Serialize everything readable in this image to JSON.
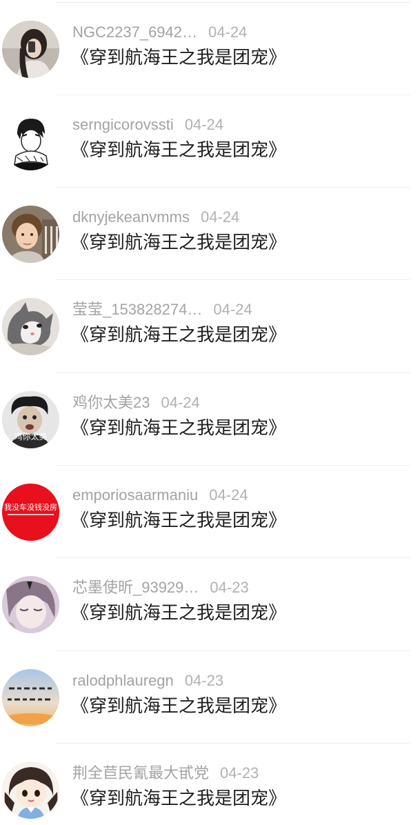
{
  "comments": [
    {
      "username": "NGC2237_6942…",
      "date": "04-24",
      "title": "《穿到航海王之我是团宠》",
      "avatar": "girl-phone-avatar"
    },
    {
      "username": "serngicorovssti",
      "date": "04-24",
      "title": "《穿到航海王之我是团宠》",
      "avatar": "anime-boy-avatar"
    },
    {
      "username": "dknyjekeanvmms",
      "date": "04-24",
      "title": "《穿到航海王之我是团宠》",
      "avatar": "child-photo-avatar"
    },
    {
      "username": "莹莹_153828274…",
      "date": "04-24",
      "title": "《穿到航海王之我是团宠》",
      "avatar": "cat-avatar"
    },
    {
      "username": "鸡你太美23",
      "date": "04-24",
      "title": "《穿到航海王之我是团宠》",
      "avatar": "meme-avatar",
      "avatar_text": "鸡你太美"
    },
    {
      "username": "emporiosaarmaniu",
      "date": "04-24",
      "title": "《穿到航海王之我是团宠》",
      "avatar": "red-text-avatar",
      "avatar_text": "我没车没钱没房"
    },
    {
      "username": "芯墨使昕_93929…",
      "date": "04-23",
      "title": "《穿到航海王之我是团宠》",
      "avatar": "anime-girl-avatar"
    },
    {
      "username": "ralodphlauregn",
      "date": "04-23",
      "title": "《穿到航海王之我是团宠》",
      "avatar": "sky-calligraphy-avatar"
    },
    {
      "username": "荆全苣民氰最大甙党",
      "date": "04-23",
      "title": "《穿到航海王之我是团宠》",
      "avatar": "chibi-girl-avatar"
    }
  ],
  "colors": {
    "username": "#a3a3a3",
    "date": "#b1b1b1",
    "title": "#1e1e1e",
    "divider": "#efefef",
    "red_avatar": "#e8101c"
  }
}
